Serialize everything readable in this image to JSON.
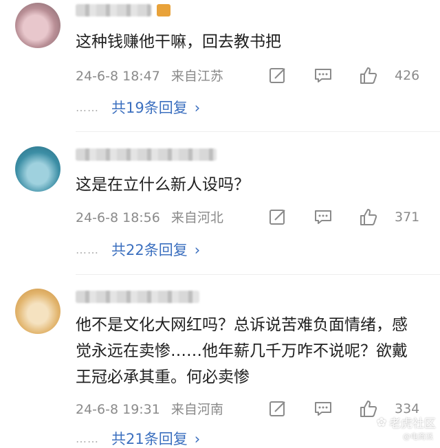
{
  "comments": [
    {
      "username": "嘻嘻猪 126",
      "text": "这种钱赚他干嘛，回去教书把",
      "time": "24-6-8 18:47",
      "location": "来自江苏",
      "likes": "426",
      "replies": "共19条回复",
      "avatar_color": "#c9a6ad"
    },
    {
      "username": "",
      "text": "这是在立什么新人设吗？",
      "time": "24-6-8 18:56",
      "location": "来自河北",
      "likes": "371",
      "replies": "共22条回复",
      "avatar_color": "#4aa3b8"
    },
    {
      "username": "",
      "text": "他不是文化大网红吗？总诉说苦难负面情绪，感觉永远在卖惨……他年薪几千万咋不说呢？欲戴王冠必承其重。何必卖惨",
      "time": "24-6-8 19:31",
      "location": "来自河南",
      "likes": "334",
      "replies": "共21条回复",
      "avatar_color": "#e6c08a"
    }
  ],
  "more_dots": "……",
  "watermark": {
    "main": "老虎社区",
    "sub": "@电商派"
  },
  "icons": [
    "comment-forward-icon",
    "comment-reply-icon",
    "thumbs-up-icon",
    "chevron-right-icon"
  ],
  "colors": {
    "link": "#3b6fbf",
    "meta": "#8a8a8a",
    "text": "#1f1f1f"
  }
}
